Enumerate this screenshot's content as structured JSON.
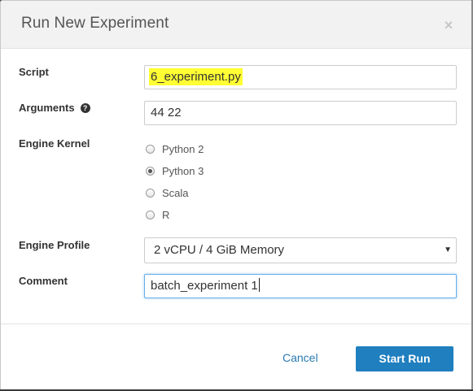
{
  "dialog": {
    "title": "Run New Experiment",
    "close_glyph": "×"
  },
  "form": {
    "script": {
      "label": "Script",
      "value": "6_experiment.py",
      "highlight_color": "#ffff33"
    },
    "arguments": {
      "label": "Arguments",
      "help_glyph": "?",
      "value": "44 22"
    },
    "engine_kernel": {
      "label": "Engine Kernel",
      "options": [
        "Python 2",
        "Python 3",
        "Scala",
        "R"
      ],
      "selected": "Python 3"
    },
    "engine_profile": {
      "label": "Engine Profile",
      "value": "2 vCPU / 4 GiB Memory",
      "arrow_glyph": "▼"
    },
    "comment": {
      "label": "Comment",
      "value": "batch_experiment 1"
    }
  },
  "footer": {
    "cancel_label": "Cancel",
    "submit_label": "Start Run"
  },
  "colors": {
    "primary_button": "#1f7fbf",
    "link": "#2a7ab0",
    "header_bg": "#f2f2f2",
    "focus_border": "#66afe9"
  },
  "icons": {
    "close": "close-icon",
    "help": "help-icon",
    "dropdown": "chevron-down-icon"
  }
}
